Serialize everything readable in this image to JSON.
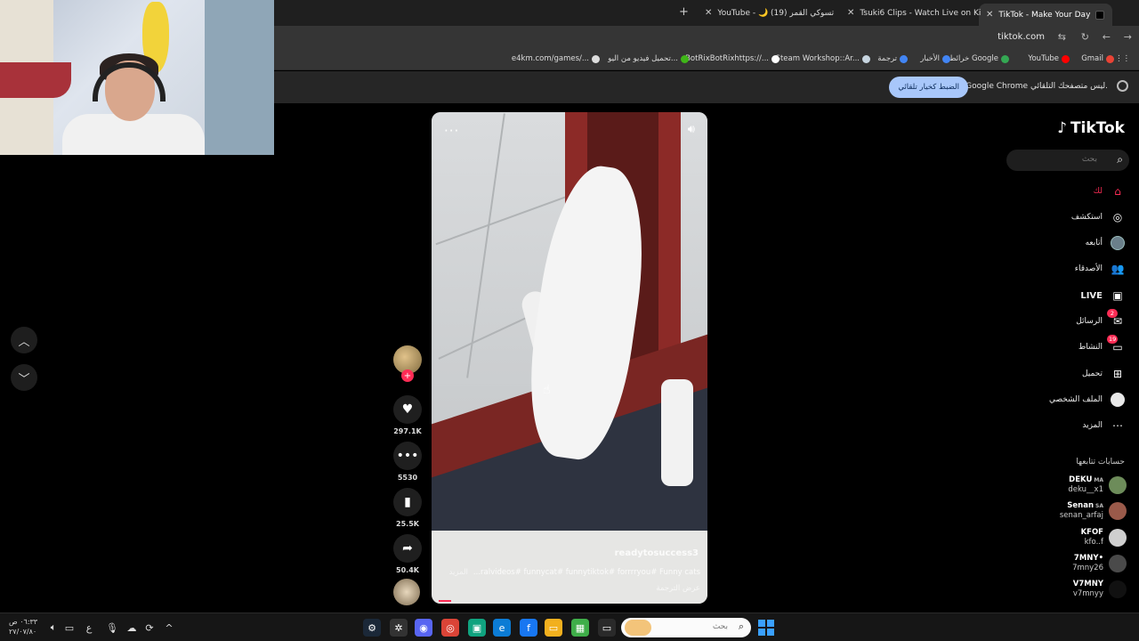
{
  "tabs": [
    {
      "title": "TikTok - Make Your Day",
      "active": true
    },
    {
      "title": "Tsuki6 Clips - Watch Live on Ki",
      "active": false
    },
    {
      "title": "YouTube - 🌙 (19) تسوكي القمر",
      "active": false
    }
  ],
  "new_tab_icon": "+",
  "address": {
    "url": "tiktok.com"
  },
  "bookmarks": [
    {
      "label": "Gmail",
      "color": "#ea4335"
    },
    {
      "label": "YouTube",
      "color": "#ff0000"
    },
    {
      "label": "خرائط Google",
      "color": "#34a853"
    },
    {
      "label": "الأخبار",
      "color": "#4285f4"
    },
    {
      "label": "ترجمة",
      "color": "#4285f4"
    },
    {
      "label": "Steam Workshop::Ar...",
      "color": "#1b2838"
    },
    {
      "label": "BotRixBotRixhttps://...",
      "color": "#ffffff"
    },
    {
      "label": "تحميل فيديو من اليو...",
      "color": "#3fb618"
    },
    {
      "label": "e4km.com/games/...",
      "color": "#dddddd"
    }
  ],
  "infobar": {
    "message": "Google Chrome ليس متصفحك التلقائي.",
    "button": "الضبط كخيار تلقائي"
  },
  "tiktok": {
    "logo": "TikTok",
    "search_placeholder": "بحث",
    "nav": [
      {
        "label": "لك",
        "icon": "home-icon",
        "glyph": "⌂",
        "active": true
      },
      {
        "label": "استكشف",
        "icon": "compass-icon",
        "glyph": "◎",
        "active": false
      },
      {
        "label": "أتابعه",
        "icon": "following-avatar-icon",
        "glyph": "●",
        "active": false
      },
      {
        "label": "الأصدقاء",
        "icon": "friends-icon",
        "glyph": "👥",
        "active": false
      },
      {
        "label": "LIVE",
        "icon": "live-icon",
        "glyph": "▣",
        "active": false
      },
      {
        "label": "الرسائل",
        "icon": "messages-icon",
        "glyph": "✉",
        "badge": "2",
        "active": false
      },
      {
        "label": "النشاط",
        "icon": "activity-icon",
        "glyph": "▭",
        "badge": "19",
        "active": false
      },
      {
        "label": "تحميل",
        "icon": "upload-icon",
        "glyph": "⊞",
        "active": false
      },
      {
        "label": "الملف الشخصي",
        "icon": "profile-icon",
        "glyph": "◯",
        "active": false
      },
      {
        "label": "المزيد",
        "icon": "more-icon",
        "glyph": "⋯",
        "active": false
      }
    ],
    "following_header": "حسابات تتابعها",
    "following": [
      {
        "name": "DEKU",
        "tag": "MA",
        "handle": "deku__x1",
        "color": "#6d8c5a"
      },
      {
        "name": "Senan",
        "tag": "SA",
        "handle": "senan_arfaj",
        "color": "#9a5a4a"
      },
      {
        "name": "KFOF",
        "tag": "",
        "handle": "kfo..f",
        "color": "#cfcfcf"
      },
      {
        "name": "7MNY•",
        "tag": "",
        "handle": "7mny26",
        "color": "#4a4a4a"
      },
      {
        "name": "V7MNY",
        "tag": "",
        "handle": "v7mnyy",
        "color": "#111111"
      }
    ],
    "video": {
      "username": "readytosuccess3",
      "caption": "...ralvideos# funnycat# funnytiktok# forrrryou# Funny cats",
      "more": "المزيد",
      "translate": "عرض الترجمة"
    },
    "actions": {
      "likes": "297.1K",
      "comments": "5530",
      "saves": "25.5K",
      "shares": "50.4K"
    }
  },
  "taskbar": {
    "time": "٠٦:٣٣ ص",
    "date": "٢٧/٠٧/٨٠",
    "lang": "ع",
    "search_placeholder": "بحث"
  },
  "colors": {
    "accent": "#fe2c55",
    "infobar_button": "#a8c7fa"
  }
}
